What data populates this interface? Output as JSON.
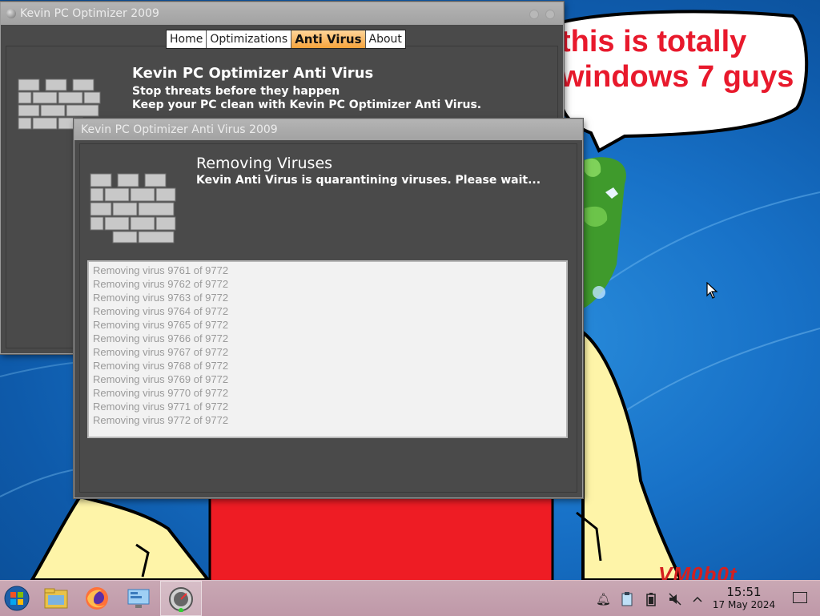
{
  "bubble": {
    "line1": "this is totally",
    "line2": "windows 7 guys"
  },
  "watermark": "VM0b0t",
  "back_window": {
    "title": "Kevin PC Optimizer 2009",
    "tabs": [
      "Home",
      "Optimizations",
      "Anti Virus",
      "About"
    ],
    "active_tab": "Anti Virus",
    "heading": "Kevin PC Optimizer Anti Virus",
    "line1": "Stop threats before they happen",
    "line2": "Keep your PC clean with Kevin PC Optimizer Anti Virus."
  },
  "front_window": {
    "title": "Kevin PC Optimizer Anti Virus 2009",
    "heading": "Removing Viruses",
    "subtext": "Kevin Anti Virus is quarantining viruses. Please wait...",
    "log": [
      "Removing virus 9761 of 9772",
      "Removing virus 9762 of 9772",
      "Removing virus 9763 of 9772",
      "Removing virus 9764 of 9772",
      "Removing virus 9765 of 9772",
      "Removing virus 9766 of 9772",
      "Removing virus 9767 of 9772",
      "Removing virus 9768 of 9772",
      "Removing virus 9769 of 9772",
      "Removing virus 9770 of 9772",
      "Removing virus 9771 of 9772",
      "Removing virus 9772 of 9772"
    ]
  },
  "taskbar": {
    "apps": [
      "start-orb-icon",
      "file-manager-icon",
      "firefox-icon",
      "control-panel-icon",
      "kevin-optimizer-icon"
    ],
    "tray_icons": [
      "notification-bell-icon",
      "clipboard-icon",
      "battery-icon",
      "volume-muted-icon",
      "tray-expand-chevron-icon"
    ],
    "time": "15:51",
    "date": "17 May 2024"
  },
  "colors": {
    "desktop_blue": "#1872c8",
    "bubble_text": "#e8192c",
    "character_red": "#ee1c24",
    "character_skin": "#fef4a8",
    "active_tab": "#f7a43c",
    "window_body": "#4a4a4a",
    "taskbar": "#c4a0ae"
  }
}
